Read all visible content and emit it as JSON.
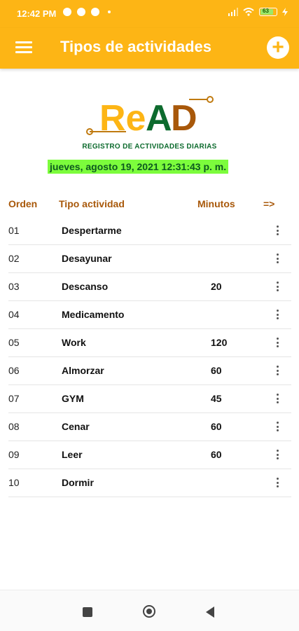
{
  "status_bar": {
    "time": "12:42 PM",
    "battery_level": "63",
    "icons": [
      "notification-icon",
      "sync-icon",
      "blocked-icon",
      "dot-icon",
      "signal-icon",
      "wifi-icon",
      "battery-icon",
      "charging-icon"
    ]
  },
  "appbar": {
    "title": "Tipos de actividades",
    "menu_icon": "hamburger-menu-icon",
    "add_icon": "plus-icon",
    "color": "#FDB515"
  },
  "logo": {
    "text_re": "Re",
    "text_a": "A",
    "text_d": "D",
    "tagline": "REGISTRO DE ACTIVIDADES DIARIAS"
  },
  "datetime": "jueves, agosto 19, 2021 12:31:43 p. m.",
  "table": {
    "headers": {
      "orden": "Orden",
      "tipo": "Tipo actividad",
      "minutos": "Minutos",
      "arrow": "=>"
    },
    "rows": [
      {
        "orden": "01",
        "tipo": "Despertarme",
        "minutos": ""
      },
      {
        "orden": "02",
        "tipo": "Desayunar",
        "minutos": ""
      },
      {
        "orden": "03",
        "tipo": "Descanso",
        "minutos": "20"
      },
      {
        "orden": "04",
        "tipo": "Medicamento",
        "minutos": ""
      },
      {
        "orden": "05",
        "tipo": "Work",
        "minutos": "120"
      },
      {
        "orden": "06",
        "tipo": "Almorzar",
        "minutos": "60"
      },
      {
        "orden": "07",
        "tipo": "GYM",
        "minutos": "45"
      },
      {
        "orden": "08",
        "tipo": "Cenar",
        "minutos": "60"
      },
      {
        "orden": "09",
        "tipo": "Leer",
        "minutos": "60"
      },
      {
        "orden": "10",
        "tipo": "Dormir",
        "minutos": ""
      }
    ]
  },
  "navbar": {
    "icons": [
      "recents-square-icon",
      "home-circle-icon",
      "back-triangle-icon"
    ]
  }
}
